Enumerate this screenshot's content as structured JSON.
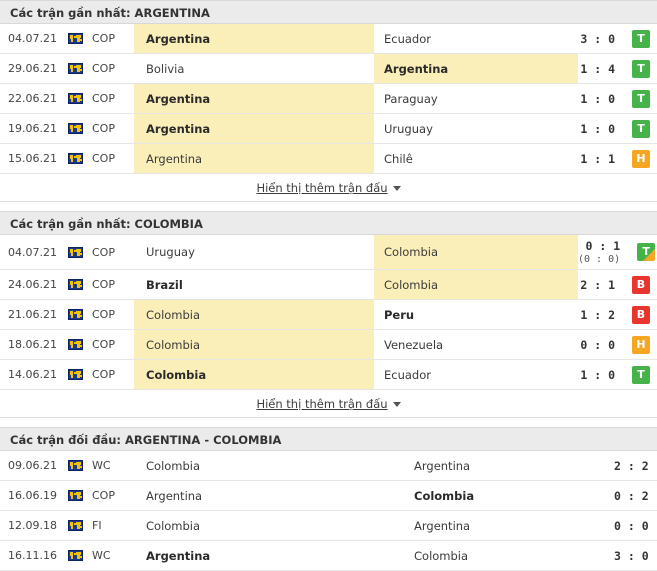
{
  "sections": [
    {
      "id": "recent-argentina",
      "title": "Các trận gần nhất: ARGENTINA",
      "show_more_label": "Hiển thị thêm trận đấu",
      "rows": [
        {
          "date": "04.07.21",
          "flag_icon": "world-map-icon",
          "competition": "COP",
          "home": "Argentina",
          "away": "Ecuador",
          "home_bold": true,
          "away_bold": false,
          "home_hl": true,
          "away_hl": false,
          "score": "3 : 0",
          "sub_score": "",
          "result": "T",
          "result_type": "win",
          "penalty": false
        },
        {
          "date": "29.06.21",
          "flag_icon": "world-map-icon",
          "competition": "COP",
          "home": "Bolivia",
          "away": "Argentina",
          "home_bold": false,
          "away_bold": true,
          "home_hl": false,
          "away_hl": true,
          "score": "1 : 4",
          "sub_score": "",
          "result": "T",
          "result_type": "win",
          "penalty": false
        },
        {
          "date": "22.06.21",
          "flag_icon": "world-map-icon",
          "competition": "COP",
          "home": "Argentina",
          "away": "Paraguay",
          "home_bold": true,
          "away_bold": false,
          "home_hl": true,
          "away_hl": false,
          "score": "1 : 0",
          "sub_score": "",
          "result": "T",
          "result_type": "win",
          "penalty": false
        },
        {
          "date": "19.06.21",
          "flag_icon": "world-map-icon",
          "competition": "COP",
          "home": "Argentina",
          "away": "Uruguay",
          "home_bold": true,
          "away_bold": false,
          "home_hl": true,
          "away_hl": false,
          "score": "1 : 0",
          "sub_score": "",
          "result": "T",
          "result_type": "win",
          "penalty": false
        },
        {
          "date": "15.06.21",
          "flag_icon": "world-map-icon",
          "competition": "COP",
          "home": "Argentina",
          "away": "Chilê",
          "home_bold": false,
          "away_bold": false,
          "home_hl": true,
          "away_hl": false,
          "score": "1 : 1",
          "sub_score": "",
          "result": "H",
          "result_type": "draw",
          "penalty": false
        }
      ]
    },
    {
      "id": "recent-colombia",
      "title": "Các trận gần nhất: COLOMBIA",
      "show_more_label": "Hiển thị thêm trận đấu",
      "rows": [
        {
          "date": "04.07.21",
          "flag_icon": "world-map-icon",
          "competition": "COP",
          "home": "Uruguay",
          "away": "Colombia",
          "home_bold": false,
          "away_bold": false,
          "home_hl": false,
          "away_hl": true,
          "score": "0 : 1",
          "sub_score": "(0 : 0)",
          "result": "T",
          "result_type": "win",
          "penalty": true
        },
        {
          "date": "24.06.21",
          "flag_icon": "world-map-icon",
          "competition": "COP",
          "home": "Brazil",
          "away": "Colombia",
          "home_bold": true,
          "away_bold": false,
          "home_hl": false,
          "away_hl": true,
          "score": "2 : 1",
          "sub_score": "",
          "result": "B",
          "result_type": "loss",
          "penalty": false
        },
        {
          "date": "21.06.21",
          "flag_icon": "world-map-icon",
          "competition": "COP",
          "home": "Colombia",
          "away": "Peru",
          "home_bold": false,
          "away_bold": true,
          "home_hl": true,
          "away_hl": false,
          "score": "1 : 2",
          "sub_score": "",
          "result": "B",
          "result_type": "loss",
          "penalty": false
        },
        {
          "date": "18.06.21",
          "flag_icon": "world-map-icon",
          "competition": "COP",
          "home": "Colombia",
          "away": "Venezuela",
          "home_bold": false,
          "away_bold": false,
          "home_hl": true,
          "away_hl": false,
          "score": "0 : 0",
          "sub_score": "",
          "result": "H",
          "result_type": "draw",
          "penalty": false
        },
        {
          "date": "14.06.21",
          "flag_icon": "world-map-icon",
          "competition": "COP",
          "home": "Colombia",
          "away": "Ecuador",
          "home_bold": true,
          "away_bold": false,
          "home_hl": true,
          "away_hl": false,
          "score": "1 : 0",
          "sub_score": "",
          "result": "T",
          "result_type": "win",
          "penalty": false
        }
      ]
    },
    {
      "id": "head-to-head",
      "title": "Các trận đối đầu: ARGENTINA - COLOMBIA",
      "show_more_label": "",
      "rows": [
        {
          "date": "09.06.21",
          "flag_icon": "world-map-icon",
          "competition": "WC",
          "home": "Colombia",
          "away": "Argentina",
          "home_bold": false,
          "away_bold": false,
          "home_hl": false,
          "away_hl": false,
          "score": "2 : 2",
          "sub_score": "",
          "result": "",
          "result_type": "",
          "penalty": false
        },
        {
          "date": "16.06.19",
          "flag_icon": "world-map-icon",
          "competition": "COP",
          "home": "Argentina",
          "away": "Colombia",
          "home_bold": false,
          "away_bold": true,
          "home_hl": false,
          "away_hl": false,
          "score": "0 : 2",
          "sub_score": "",
          "result": "",
          "result_type": "",
          "penalty": false
        },
        {
          "date": "12.09.18",
          "flag_icon": "world-map-icon",
          "competition": "FI",
          "home": "Colombia",
          "away": "Argentina",
          "home_bold": false,
          "away_bold": false,
          "home_hl": false,
          "away_hl": false,
          "score": "0 : 0",
          "sub_score": "",
          "result": "",
          "result_type": "",
          "penalty": false
        },
        {
          "date": "16.11.16",
          "flag_icon": "world-map-icon",
          "competition": "WC",
          "home": "Argentina",
          "away": "Colombia",
          "home_bold": true,
          "away_bold": false,
          "home_hl": false,
          "away_hl": false,
          "score": "3 : 0",
          "sub_score": "",
          "result": "",
          "result_type": "",
          "penalty": false
        }
      ]
    }
  ],
  "colors": {
    "win": "#46b34a",
    "draw": "#f5a623",
    "loss": "#e8352e",
    "highlight": "#faeeb9",
    "header_bg": "#ebebeb"
  }
}
